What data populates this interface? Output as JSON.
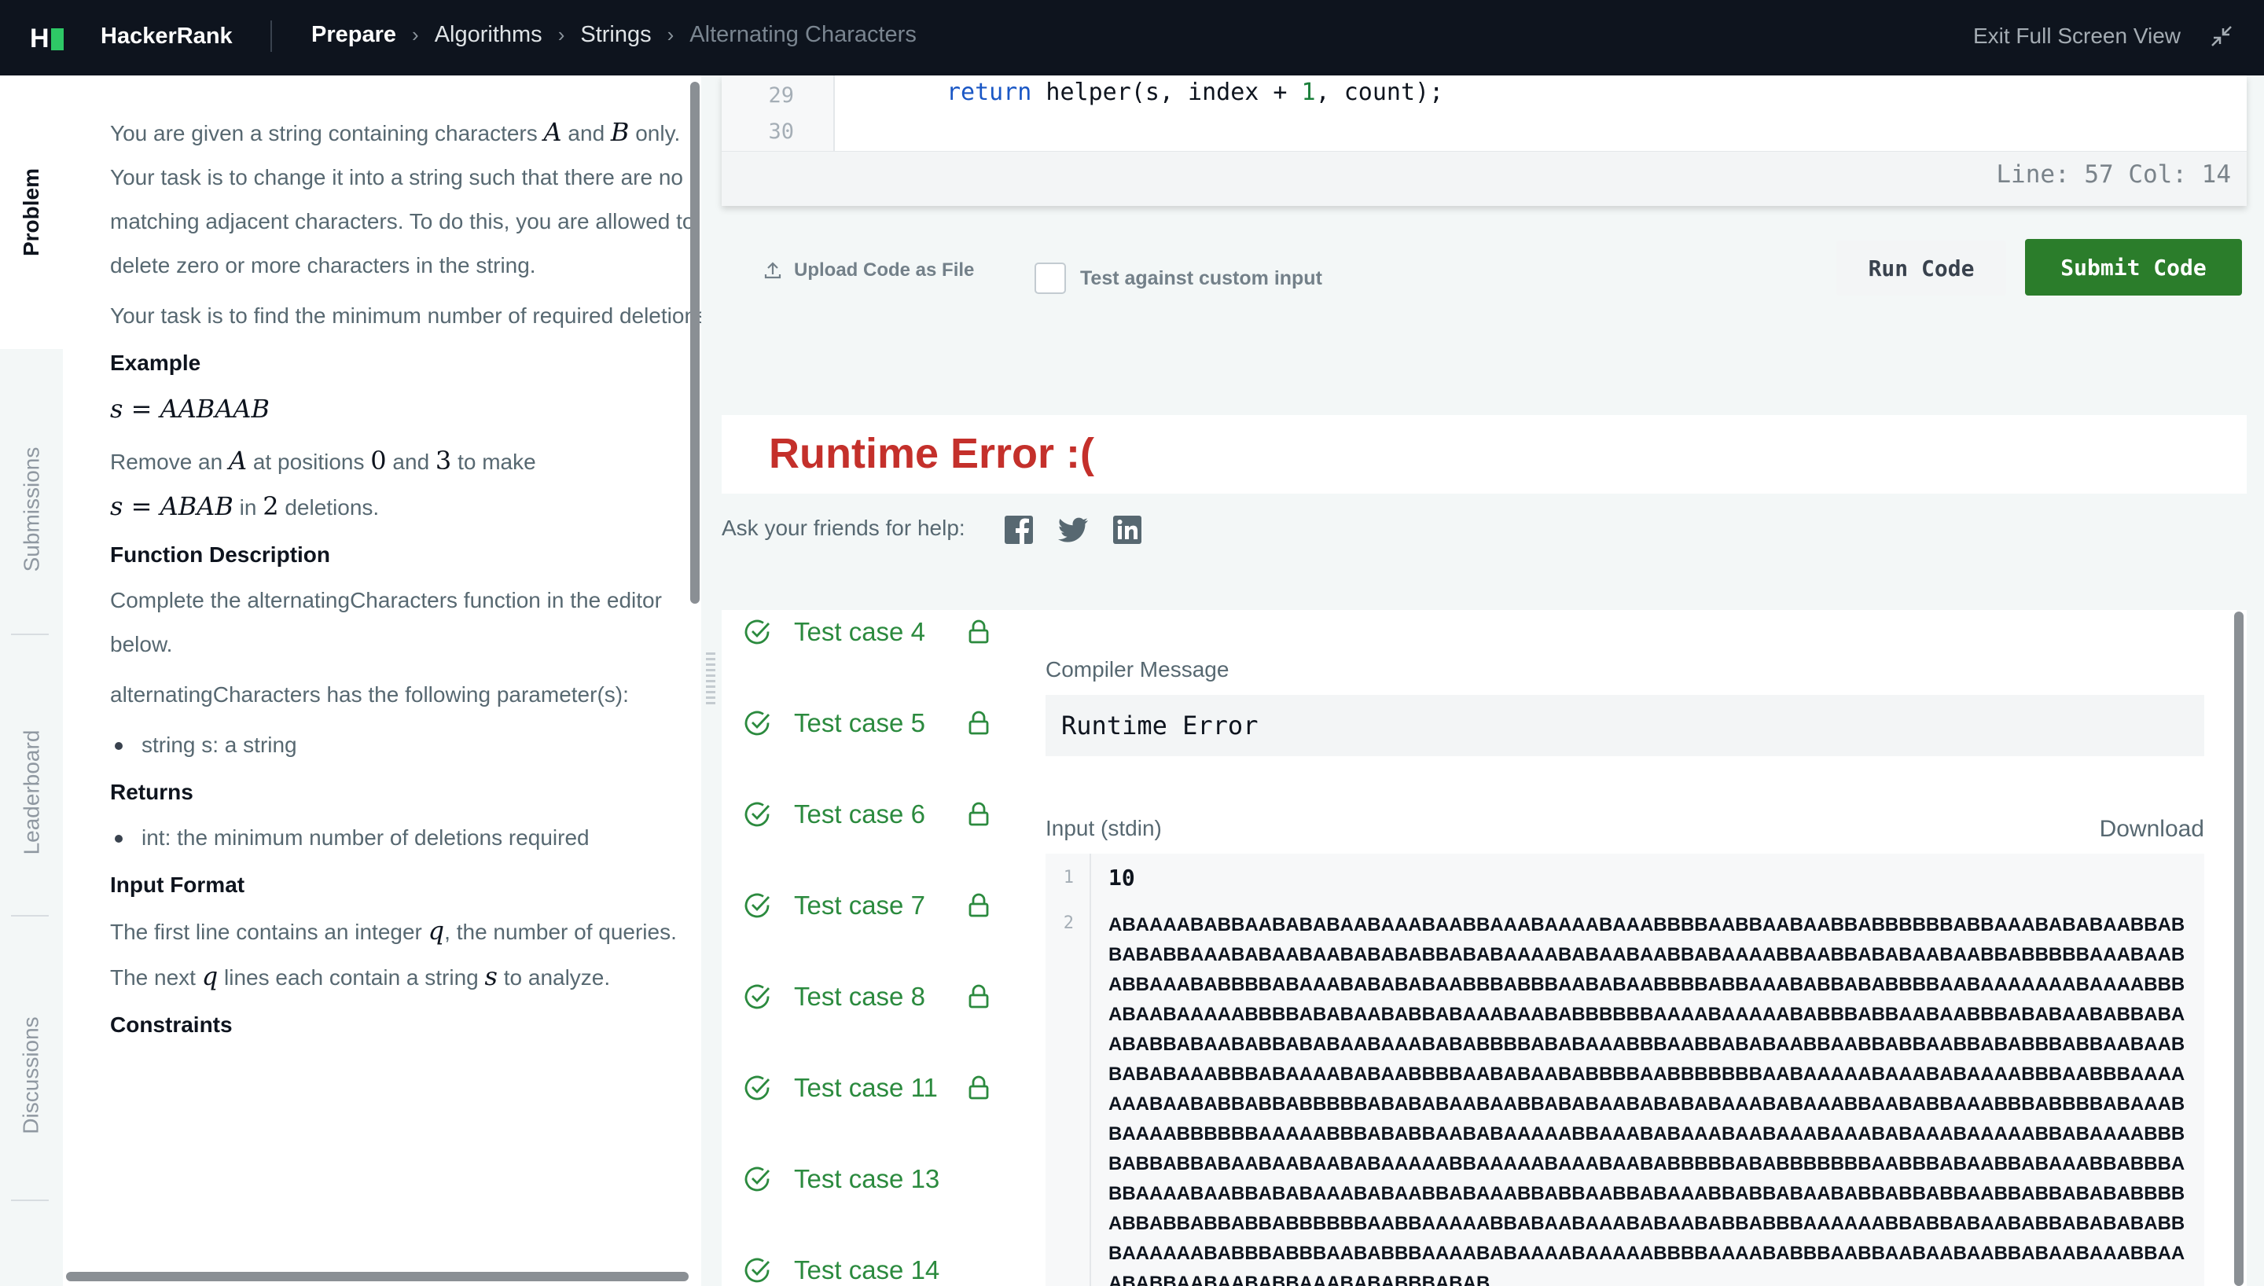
{
  "topbar": {
    "brand": "HackerRank",
    "breadcrumbs": [
      "Prepare",
      "Algorithms",
      "Strings",
      "Alternating Characters"
    ],
    "exit_fullscreen": "Exit Full Screen View"
  },
  "tabs": [
    "Problem",
    "Submissions",
    "Leaderboard",
    "Discussions"
  ],
  "problem": {
    "intro_1": "You are given a string containing characters",
    "var_a": "A",
    "and": "and",
    "var_b": "B",
    "intro_2": "only. Your task is to change it into a string such that there are no matching adjacent characters. To do this, you are allowed to delete zero or more characters in the string.",
    "task": "Your task is to find the minimum number of required deletions.",
    "example_heading": "Example",
    "example_s": "s = AABAAB",
    "remove_1": "Remove an",
    "remove_2": "at positions",
    "pos_0": "0",
    "pos_3": "3",
    "remove_3": "to make",
    "result_s": "s = ABAB",
    "in_word": "in",
    "deletions_n": "2",
    "deletions_word": "deletions.",
    "function_heading": "Function Description",
    "function_desc": "Complete the alternatingCharacters function in the editor below.",
    "params_intro": "alternatingCharacters has the following parameter(s):",
    "params": [
      "string s: a string"
    ],
    "returns_heading": "Returns",
    "returns": [
      "int: the minimum number of deletions required"
    ],
    "input_heading": "Input Format",
    "input_1a": "The first line contains an integer",
    "var_q": "q",
    "input_1b": ", the number of queries.",
    "input_2a": "The next",
    "input_2b": "lines each contain a string",
    "var_s": "s",
    "input_2c": "to analyze.",
    "constraints_heading": "Constraints"
  },
  "editor": {
    "lines": [
      {
        "number": "29",
        "keyword": "return",
        "code": " helper(s, index + ",
        "num": "1",
        "rest": ", count);"
      },
      {
        "number": "30",
        "keyword": "",
        "code": "",
        "num": "",
        "rest": ""
      }
    ],
    "status": "Line: 57 Col: 14"
  },
  "actions": {
    "upload": "Upload Code as File",
    "custom_input": "Test against custom input",
    "run": "Run Code",
    "submit": "Submit Code"
  },
  "result": {
    "title": "Runtime Error :(",
    "ask_help": "Ask your friends for help:"
  },
  "testcases": [
    "Test case 4",
    "Test case 5",
    "Test case 6",
    "Test case 7",
    "Test case 8",
    "Test case 11",
    "Test case 13",
    "Test case 14"
  ],
  "compiler": {
    "label": "Compiler Message",
    "message": "Runtime Error"
  },
  "stdin": {
    "label": "Input (stdin)",
    "download": "Download",
    "line1_number": "1",
    "line1": "10",
    "line2_number": "2",
    "line2": "ABAAAABABBAABABABAABAAABAABBAAABAAAABAAABBBBAABBAABAABBABBBBBBABBAAABABABAABBABBABABBAAABABAABAABABABABBABABAAAABABAABAABBABAAAABBAABBABABAABAABBABBBBBAAABAABABBAAABABBBBABAAABABABABAABBBABBBAABABAABBBBABBAAABABBABABBBBAABAAAAAAABAAAABBBABAABAAAAABBBBABABAABABBABAAABAABABBBBBBAAAABAAAAABABBBABBAABAABBBABABAABABBABAABABBABAABABBABABAABAAABABABBBBABABAAABBBAABBABABAABBAABBABBAABBABABBBABBAABAABBABABAAABBBABAAAABABAABBBBAABABAABABBBBAABBBBBBBAABAAAAABAAABABAAAABBBAABBBAAAAAAABAABABBABBABBBBBABABABAABAABBABABAABABABABAAABABAAABBAABABBAAABBBABBBBABAAABBAAAABBBBBBAAAAABBBABABBAABABAAAAABBAAABABAAABAABAAABAAABABAAABAAAAABBABAAAABBBBABBABBABAABAABAABABAAAAABBAAAAABAAABAABABBBBBABABBBBBBBAABBBABAABBABAAABBABBBABBAAAABAABBABABAAABABAABBABAAABBABBAABBABAAABBABBABAABABBABBABBAABBABBABABABBBBABBABBABBABBABBBBBBAABBAAAAABBABAABAAABABAABABBABBBAAAAAABBABBABAABABBABABABABBBAAAAAABABBBABBBAABABBBAAAABABAAAABAAAAABBBBAAAABABBBAABBAABAABAABBABAABAAABBAAABABBAABAABABBAAABABABBBABAB"
  }
}
